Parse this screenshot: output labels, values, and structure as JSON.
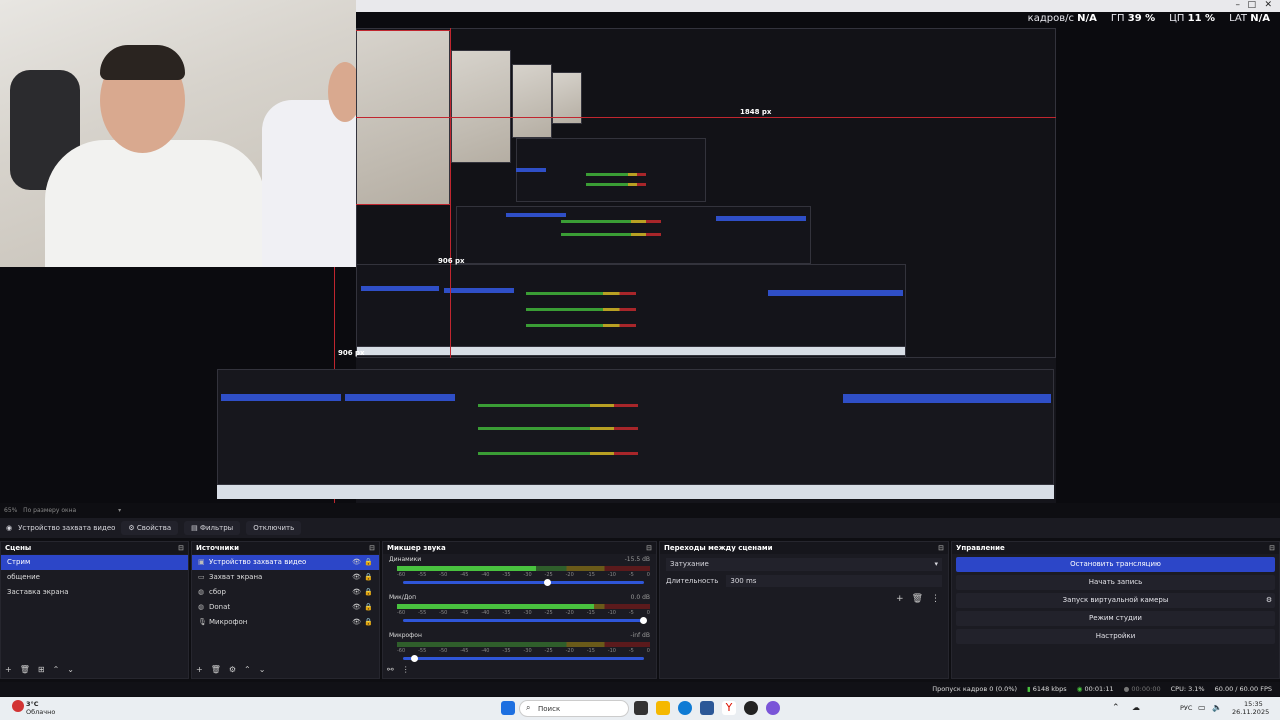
{
  "top_stats": {
    "fps_label": "кадров/с",
    "fps_value": "N/A",
    "gpu_label": "ГП",
    "gpu_value": "39 %",
    "cpu_label": "ЦП",
    "cpu_value": "11 %",
    "lat_label": "LAT",
    "lat_value": "N/A"
  },
  "nested_preview": {
    "label_1848": "1848 px",
    "label_906a": "906 px",
    "label_906b": "906 px"
  },
  "zoom": {
    "level": "65%",
    "mode": "По размеру окна"
  },
  "source_toolbar": {
    "current_source": "Устройство захвата видео",
    "properties": "Свойства",
    "filters": "Фильтры",
    "disable": "Отключить"
  },
  "scenes": {
    "title": "Сцены",
    "items": [
      "Стрим",
      "общение",
      "Заставка экрана"
    ],
    "selected_index": 0
  },
  "sources": {
    "title": "Источники",
    "items": [
      {
        "label": "Устройство захвата видео",
        "icon": "camera-icon"
      },
      {
        "label": "Захват экрана",
        "icon": "monitor-icon"
      },
      {
        "label": "сбор",
        "icon": "globe-icon"
      },
      {
        "label": "Donat",
        "icon": "globe-icon"
      },
      {
        "label": "Микрофон",
        "icon": "microphone-icon"
      }
    ]
  },
  "mixer": {
    "title": "Микшер звука",
    "channels": [
      {
        "name": "Динамики",
        "db": "-15.5 dB",
        "level": 0.55,
        "fader": 0.6
      },
      {
        "name": "Мик/Доп",
        "db": "0.0 dB",
        "level": 0.78,
        "fader": 1.0
      },
      {
        "name": "Микрофон",
        "db": "-inf dB",
        "level": 0.0,
        "fader": 0.05
      }
    ],
    "ticks": [
      "-60",
      "-55",
      "-50",
      "-45",
      "-40",
      "-35",
      "-30",
      "-25",
      "-20",
      "-15",
      "-10",
      "-5",
      "0"
    ]
  },
  "transitions": {
    "title": "Переходы между сценами",
    "selected": "Затухание",
    "duration_label": "Длительность",
    "duration_value": "300 ms"
  },
  "controls": {
    "title": "Управление",
    "buttons": [
      "Остановить трансляцию",
      "Начать запись",
      "Запуск виртуальной камеры",
      "Режим студии",
      "Настройки"
    ]
  },
  "status": {
    "dropped": "Пропуск кадров 0 (0.0%)",
    "bitrate": "6148 kbps",
    "stream_time": "00:01:11",
    "rec_time": "00:00:00",
    "cpu": "CPU: 3.1%",
    "fps": "60.00 / 60.00 FPS"
  },
  "taskbar": {
    "weather_temp": "3°C",
    "weather_desc": "Облачно",
    "search": "Поиск",
    "lang": "РУС",
    "time": "15:35",
    "date": "26.11.2025"
  },
  "colors": {
    "accent": "#2c46c8",
    "red_guide": "#c0262f"
  }
}
